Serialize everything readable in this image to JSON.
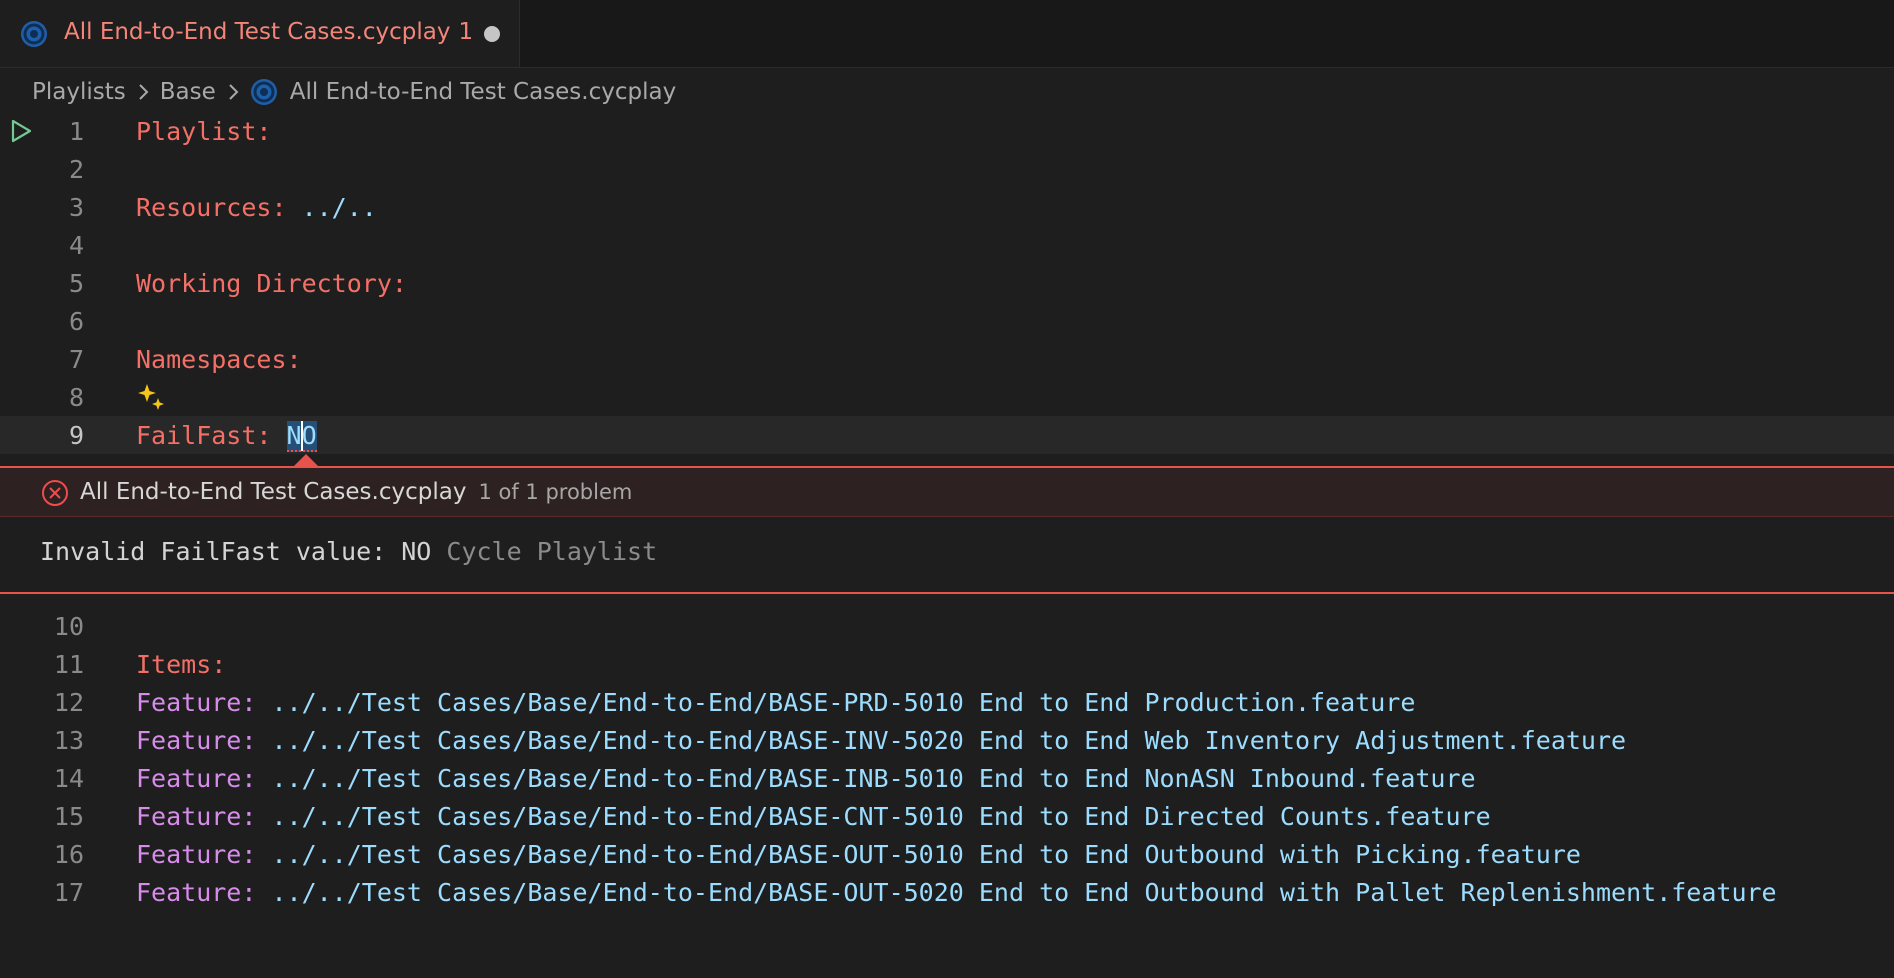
{
  "tab": {
    "title": "All End-to-End Test Cases.cycplay",
    "problem_count": "1",
    "icon": "cycle-playlist-icon",
    "dirty_indicator": "unsaved-dot"
  },
  "breadcrumb": {
    "items": [
      "Playlists",
      "Base",
      "All End-to-End Test Cases.cycplay"
    ]
  },
  "editor": {
    "lines": [
      {
        "num": "1",
        "key": "Playlist:",
        "value": ""
      },
      {
        "num": "2",
        "key": "",
        "value": ""
      },
      {
        "num": "3",
        "key": "Resources:",
        "value": " ../.."
      },
      {
        "num": "4",
        "key": "",
        "value": ""
      },
      {
        "num": "5",
        "key": "Working Directory:",
        "value": ""
      },
      {
        "num": "6",
        "key": "",
        "value": ""
      },
      {
        "num": "7",
        "key": "Namespaces:",
        "value": ""
      },
      {
        "num": "8",
        "key": "",
        "value": ""
      },
      {
        "num": "9",
        "key": "FailFast: ",
        "value": "NO"
      },
      {
        "num": "10",
        "key": "",
        "value": ""
      },
      {
        "num": "11",
        "key": "Items:",
        "value": ""
      },
      {
        "num": "12",
        "key": "Feature:",
        "value": " ../../Test Cases/Base/End-to-End/BASE-PRD-5010 End to End Production.feature"
      },
      {
        "num": "13",
        "key": "Feature:",
        "value": " ../../Test Cases/Base/End-to-End/BASE-INV-5020 End to End Web Inventory Adjustment.feature"
      },
      {
        "num": "14",
        "key": "Feature:",
        "value": " ../../Test Cases/Base/End-to-End/BASE-INB-5010 End to End NonASN Inbound.feature"
      },
      {
        "num": "15",
        "key": "Feature:",
        "value": " ../../Test Cases/Base/End-to-End/BASE-CNT-5010 End to End Directed Counts.feature"
      },
      {
        "num": "16",
        "key": "Feature:",
        "value": " ../../Test Cases/Base/End-to-End/BASE-OUT-5010 End to End Outbound with Picking.feature"
      },
      {
        "num": "17",
        "key": "Feature:",
        "value": " ../../Test Cases/Base/End-to-End/BASE-OUT-5020 End to End Outbound with Pallet Replenishment.feature"
      }
    ]
  },
  "problem": {
    "file": "All End-to-End Test Cases.cycplay",
    "count": "1 of 1 problem",
    "message": "Invalid FailFast value: NO",
    "source": "Cycle Playlist"
  },
  "colors": {
    "keyword": "#f47067",
    "feature_keyword": "#d78bea",
    "value": "#9cdcfe",
    "error_border": "#e5534b",
    "background": "#1e1e1e"
  }
}
